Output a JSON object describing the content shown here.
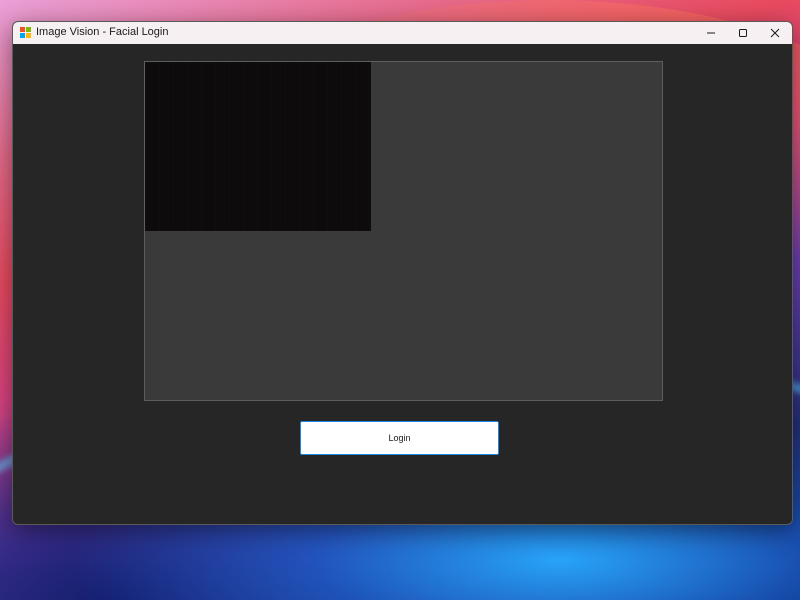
{
  "window": {
    "title": "Image Vision - Facial Login",
    "controls": {
      "minimize_icon": "minimize-icon",
      "maximize_icon": "maximize-icon",
      "close_icon": "close-icon"
    },
    "app_icon": "app-icon",
    "background_color": "#262626",
    "titlebar_color": "#f7f0f2"
  },
  "camera": {
    "panel_color": "#3a3a3a",
    "feed_color": "#0e0b0d"
  },
  "actions": {
    "login_label": "Login",
    "login_border_color": "#1e88e5"
  }
}
